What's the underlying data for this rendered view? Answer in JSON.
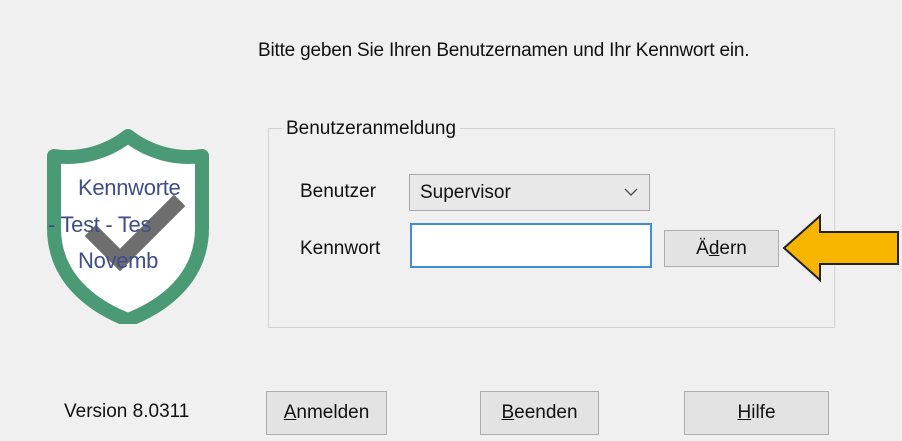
{
  "instruction": "Bitte geben Sie Ihren Benutzernamen und Ihr Kennwort ein.",
  "group_title": "Benutzeranmeldung",
  "user_label": "Benutzer",
  "user_value": "Supervisor",
  "password_label": "Kennwort",
  "password_value": "",
  "buttons": {
    "change": {
      "pre": "",
      "mnemonic": "Ä",
      "post": "ndern",
      "mnemonic_alt": "d"
    },
    "login": {
      "pre": "",
      "mnemonic": "A",
      "post": "nmelden"
    },
    "exit": {
      "pre": "",
      "mnemonic": "B",
      "post": "eenden"
    },
    "help": {
      "pre": "",
      "mnemonic": "H",
      "post": "ilfe"
    }
  },
  "version": "Version 8.0311",
  "logo": {
    "line1": "Kennworte",
    "line2": "- Test - Tes",
    "line3": "Novemb"
  },
  "colors": {
    "shield": "#4a9a75",
    "check": "#555555",
    "logo_text": "#3e4e8a",
    "input_focus": "#3f8ed8",
    "arrow_fill": "#f7b500",
    "arrow_stroke": "#222222"
  },
  "icons": {
    "logo": "shield-check-icon",
    "dropdown": "chevron-down-icon",
    "pointer": "arrow-left-icon"
  }
}
